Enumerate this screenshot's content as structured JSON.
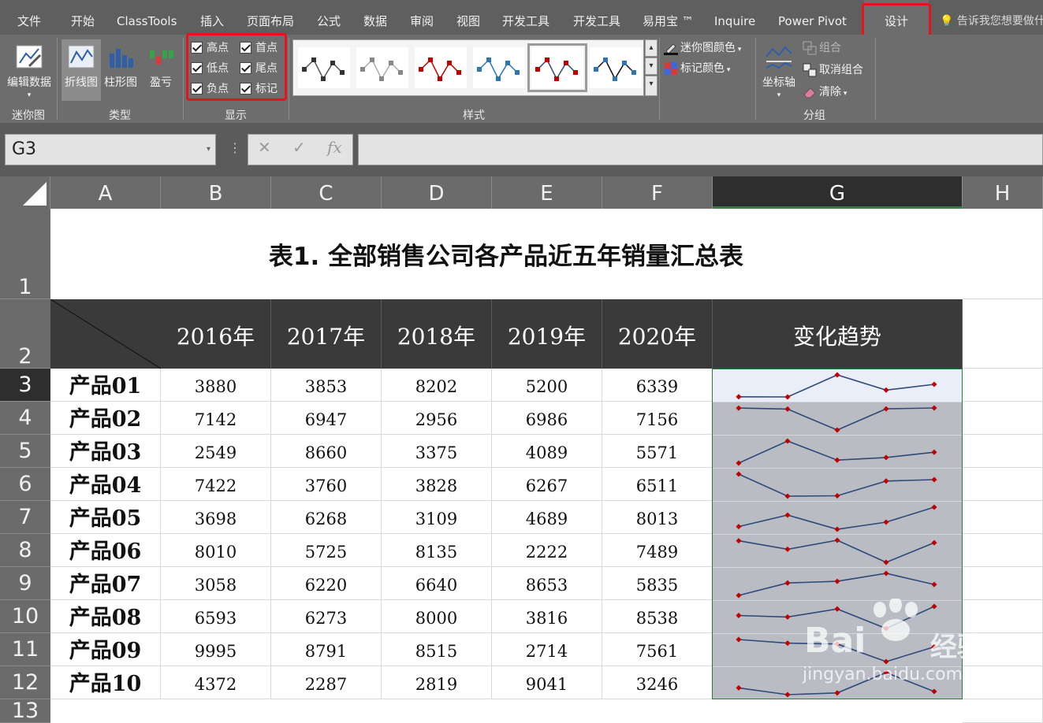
{
  "ribbon": {
    "tabs": [
      "文件",
      "开始",
      "ClassTools",
      "插入",
      "页面布局",
      "公式",
      "数据",
      "审阅",
      "视图",
      "开发工具",
      "开发工具",
      "易用宝 ™",
      "Inquire",
      "Power Pivot",
      "设计"
    ],
    "active_tab": "设计",
    "tell_me": "告诉我您想要做什"
  },
  "groups": {
    "sparkline": {
      "edit_data": "编辑数据",
      "label": "迷你图"
    },
    "type": {
      "line": "折线图",
      "column": "柱形图",
      "winloss": "盈亏",
      "label": "类型"
    },
    "show": {
      "high": "高点",
      "first": "首点",
      "low": "低点",
      "last": "尾点",
      "negative": "负点",
      "markers": "标记",
      "label": "显示"
    },
    "style": {
      "label": "样式"
    },
    "color": {
      "sparkline_color": "迷你图颜色",
      "marker_color": "标记颜色"
    },
    "group": {
      "axis": "坐标轴",
      "group": "组合",
      "ungroup": "取消组合",
      "clear": "清除",
      "label": "分组"
    }
  },
  "formula_bar": {
    "name_box": "G3",
    "cancel": "✕",
    "enter": "✓",
    "fx": "fx",
    "formula": ""
  },
  "columns": [
    "A",
    "B",
    "C",
    "D",
    "E",
    "F",
    "G",
    "H"
  ],
  "selected_column": "G",
  "rows": [
    "1",
    "2",
    "3",
    "4",
    "5",
    "6",
    "7",
    "8",
    "9",
    "10",
    "11",
    "12",
    "13"
  ],
  "selected_row": "3",
  "sheet": {
    "title": "表1. 全部销售公司各产品近五年销量汇总表",
    "headers": [
      "2016年",
      "2017年",
      "2018年",
      "2019年",
      "2020年"
    ],
    "trend_header": "变化趋势",
    "products": [
      {
        "name": "产品01",
        "values": [
          3880,
          3853,
          8202,
          5200,
          6339
        ]
      },
      {
        "name": "产品02",
        "values": [
          7142,
          6947,
          2956,
          6986,
          7156
        ]
      },
      {
        "name": "产品03",
        "values": [
          2549,
          8660,
          3375,
          4089,
          5571
        ]
      },
      {
        "name": "产品04",
        "values": [
          7422,
          3760,
          3828,
          6267,
          6511
        ]
      },
      {
        "name": "产品05",
        "values": [
          3698,
          6268,
          3109,
          4689,
          8013
        ]
      },
      {
        "name": "产品06",
        "values": [
          8010,
          5725,
          8135,
          2222,
          7489
        ]
      },
      {
        "name": "产品07",
        "values": [
          3058,
          6220,
          6640,
          8653,
          5835
        ]
      },
      {
        "name": "产品08",
        "values": [
          6593,
          6273,
          8000,
          3816,
          8538
        ]
      },
      {
        "name": "产品09",
        "values": [
          9995,
          8791,
          8515,
          2714,
          7561
        ]
      },
      {
        "name": "产品10",
        "values": [
          4372,
          2287,
          2819,
          9041,
          3246
        ]
      }
    ]
  },
  "colors": {
    "sparkline": "#2e4a7a",
    "marker": "#c00000",
    "highlight_box": "#e8131a"
  },
  "watermark": {
    "main": "Bai",
    "cn": "经验",
    "url": "jingyan.baidu.com"
  }
}
